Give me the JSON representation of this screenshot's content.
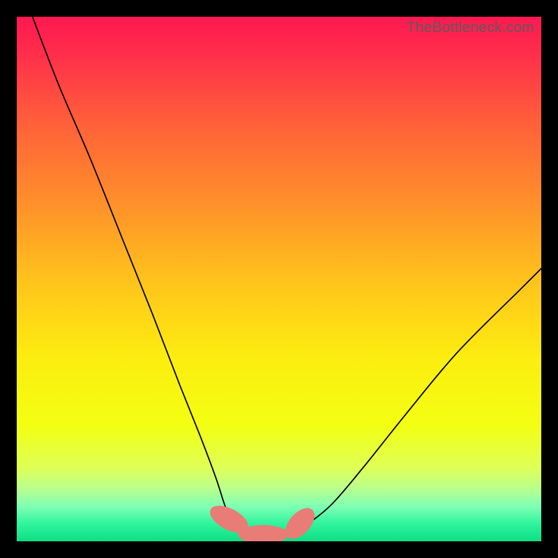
{
  "watermark": "TheBottleneck.com",
  "colors": {
    "frame": "#000000",
    "curve_stroke": "#000000",
    "marker_fill": "#e97c77",
    "gradient_stops": [
      {
        "offset": 0,
        "color": "#ff1851"
      },
      {
        "offset": 0.06,
        "color": "#ff2a4c"
      },
      {
        "offset": 0.2,
        "color": "#ff5f3a"
      },
      {
        "offset": 0.35,
        "color": "#ff8e2b"
      },
      {
        "offset": 0.5,
        "color": "#ffc21c"
      },
      {
        "offset": 0.65,
        "color": "#fced10"
      },
      {
        "offset": 0.78,
        "color": "#f3ff12"
      },
      {
        "offset": 0.86,
        "color": "#deff57"
      },
      {
        "offset": 0.9,
        "color": "#b9ff8f"
      },
      {
        "offset": 0.935,
        "color": "#7cffb4"
      },
      {
        "offset": 0.965,
        "color": "#33f59e"
      },
      {
        "offset": 1.0,
        "color": "#0ddf84"
      }
    ]
  },
  "chart_data": {
    "type": "line",
    "title": "",
    "xlabel": "",
    "ylabel": "",
    "xlim": [
      0,
      100
    ],
    "ylim": [
      0,
      100
    ],
    "series": [
      {
        "name": "bottleneck-curve",
        "x": [
          3,
          8,
          14,
          20,
          26,
          31,
          35,
          38,
          40,
          42,
          44,
          46,
          48,
          50,
          52,
          55,
          60,
          66,
          74,
          84,
          96,
          100
        ],
        "y": [
          100,
          87,
          73,
          58,
          43,
          30,
          20,
          12,
          6,
          3,
          1.8,
          1.4,
          1.3,
          1.3,
          1.6,
          3,
          7,
          14,
          24,
          36,
          48,
          52
        ]
      }
    ],
    "markers": [
      {
        "name": "marker-left",
        "cx": 40.5,
        "cy": 4.2,
        "rx": 2.0,
        "ry": 4.0,
        "angle": -62
      },
      {
        "name": "marker-bottom",
        "cx": 47.0,
        "cy": 1.3,
        "rx": 4.8,
        "ry": 1.8,
        "angle": 0
      },
      {
        "name": "marker-right",
        "cx": 54.0,
        "cy": 3.4,
        "rx": 2.0,
        "ry": 3.5,
        "angle": 42
      }
    ]
  }
}
